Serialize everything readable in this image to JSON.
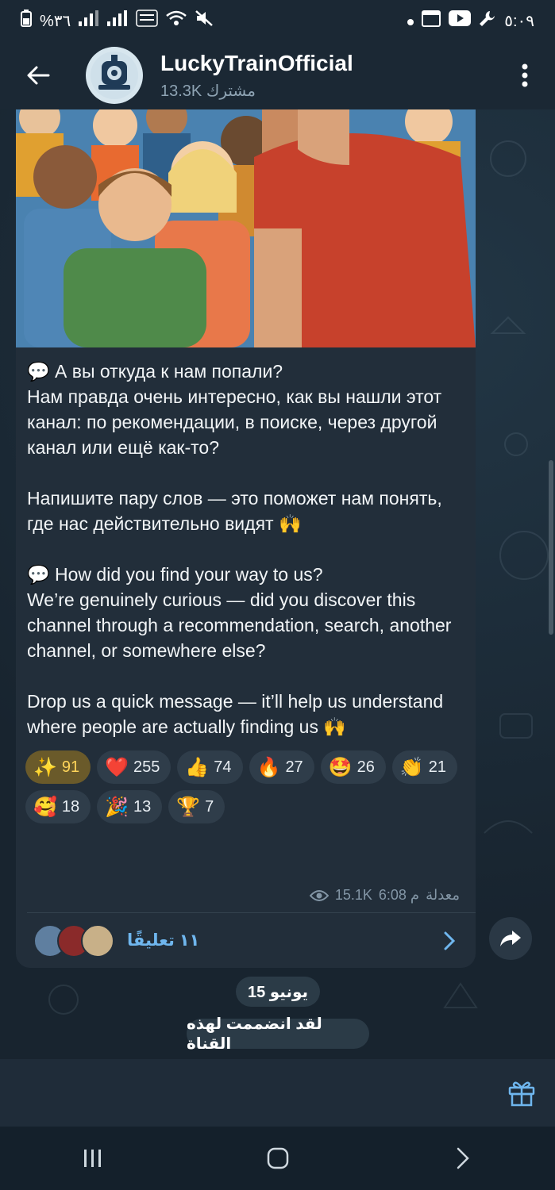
{
  "status_bar": {
    "battery": "%٣٦",
    "time": "٥:٠٩"
  },
  "header": {
    "title": "LuckyTrainOfficial",
    "subscribers": "13.3K مشترك"
  },
  "message": {
    "text_ru": "💬 А вы откуда к нам попали?\nНам правда очень интересно, как вы нашли этот канал: по рекомендации, в поиске, через другой канал или ещё как-то?\n\nНапишите пару слов — это поможет нам понять, где нас действительно видят 🙌",
    "text_en": "💬 How did you find your way to us?\nWe’re genuinely curious — did you discover this channel through a recommendation, search, another channel, or somewhere else?\n\nDrop us a quick message — it’ll help us understand where people are actually finding us 🙌",
    "reactions": [
      {
        "emoji": "✨",
        "count": "91"
      },
      {
        "emoji": "❤️",
        "count": "255"
      },
      {
        "emoji": "👍",
        "count": "74"
      },
      {
        "emoji": "🔥",
        "count": "27"
      },
      {
        "emoji": "🤩",
        "count": "26"
      },
      {
        "emoji": "👏",
        "count": "21"
      },
      {
        "emoji": "🥰",
        "count": "18"
      },
      {
        "emoji": "🎉",
        "count": "13"
      },
      {
        "emoji": "🏆",
        "count": "7"
      }
    ],
    "edited_label": "معدلة",
    "time": "6:08 م",
    "views": "15.1K",
    "comments_label": "١١ تعليقًا"
  },
  "date_pill": "15 يونيو",
  "service_message": "لقد انضممت لهذه القناة",
  "icons": {
    "back": "back-arrow-icon",
    "menu": "more-vertical-icon",
    "views": "eye-icon",
    "share": "share-arrow-icon",
    "gift": "gift-icon"
  },
  "colors": {
    "accent": "#6fb6ee",
    "bubble": "#222e3a",
    "header": "#1b2834"
  }
}
